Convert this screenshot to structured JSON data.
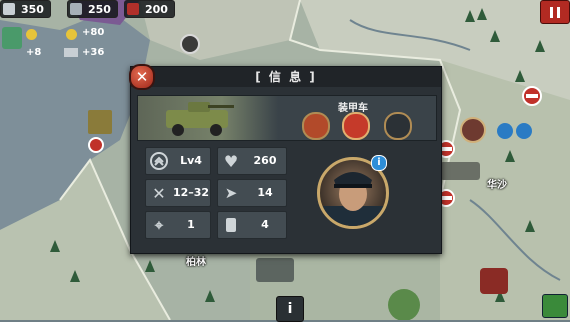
{
  "hud": {
    "manpower": "350",
    "industry": "250",
    "oil": "200",
    "gold": "+80",
    "medals": "+8",
    "steel": "+36"
  },
  "dialog": {
    "title": "[ 信 息 ]",
    "close_label": "✕",
    "unit_type": "装甲车",
    "stats": {
      "level": "Lv4",
      "hp": "260",
      "attack": "12–32",
      "defense": "14",
      "range": "1",
      "moves": "4"
    },
    "info_badge": "i"
  },
  "map": {
    "labels": [
      "华沙",
      "柏林"
    ]
  },
  "bottom": {
    "info_label": "i"
  },
  "colors": {
    "pause": "#b22a22",
    "panel": "#2b3136",
    "red_unit": "#c0312a"
  }
}
